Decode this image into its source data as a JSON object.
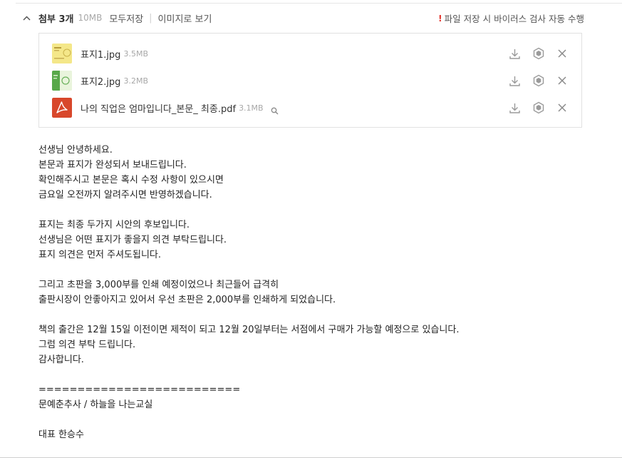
{
  "attachments": {
    "title": "첨부 3개",
    "total_size": "10MB",
    "save_all_label": "모두저장",
    "view_as_image_label": "이미지로 보기",
    "virus_notice": "파일 저장 시 바이러스 검사 자동 수행",
    "files": [
      {
        "name": "표지1.jpg",
        "size": "3.5MB",
        "icon": "cover-yellow-thumbnail"
      },
      {
        "name": "표지2.jpg",
        "size": "3.2MB",
        "icon": "cover-green-thumbnail"
      },
      {
        "name": "나의 직업은 엄마입니다_본문_ 최종.pdf",
        "size": "3.1MB",
        "icon": "pdf-icon"
      }
    ],
    "colors": {
      "pdf_red": "#d8472b",
      "warning_red": "#e4372f",
      "muted": "#a8a8a8"
    }
  },
  "body": {
    "lines": [
      "선생님 안녕하세요.",
      "본문과 표지가 완성되서 보내드립니다.",
      "확인해주시고 본문은 혹시 수정 사항이 있으시면",
      "금요일 오전까지 알려주시면 반영하겠습니다.",
      "",
      "표지는 최종 두가지 시안의 후보입니다.",
      "선생님은 어떤 표지가 좋을지 의견 부탁드립니다.",
      "표지 의견은 먼저 주셔도됩니다.",
      "",
      "그리고 초판을 3,000부를 인쇄 예정이었으나 최근들어 급격히",
      "출판시장이 안좋아지고 있어서 우선 초판은 2,000부를 인쇄하게 되었습니다.",
      "",
      "책의 출간은 12월 15일 이전이면 제적이 되고 12월 20일부터는 서점에서 구매가 가능할 예정으로 있습니다.",
      "그럼 의견 부탁 드립니다.",
      "감사합니다.",
      "",
      "==========================",
      "문예춘추사 / 하늘을 나는교실",
      "",
      "대표 한승수"
    ]
  }
}
